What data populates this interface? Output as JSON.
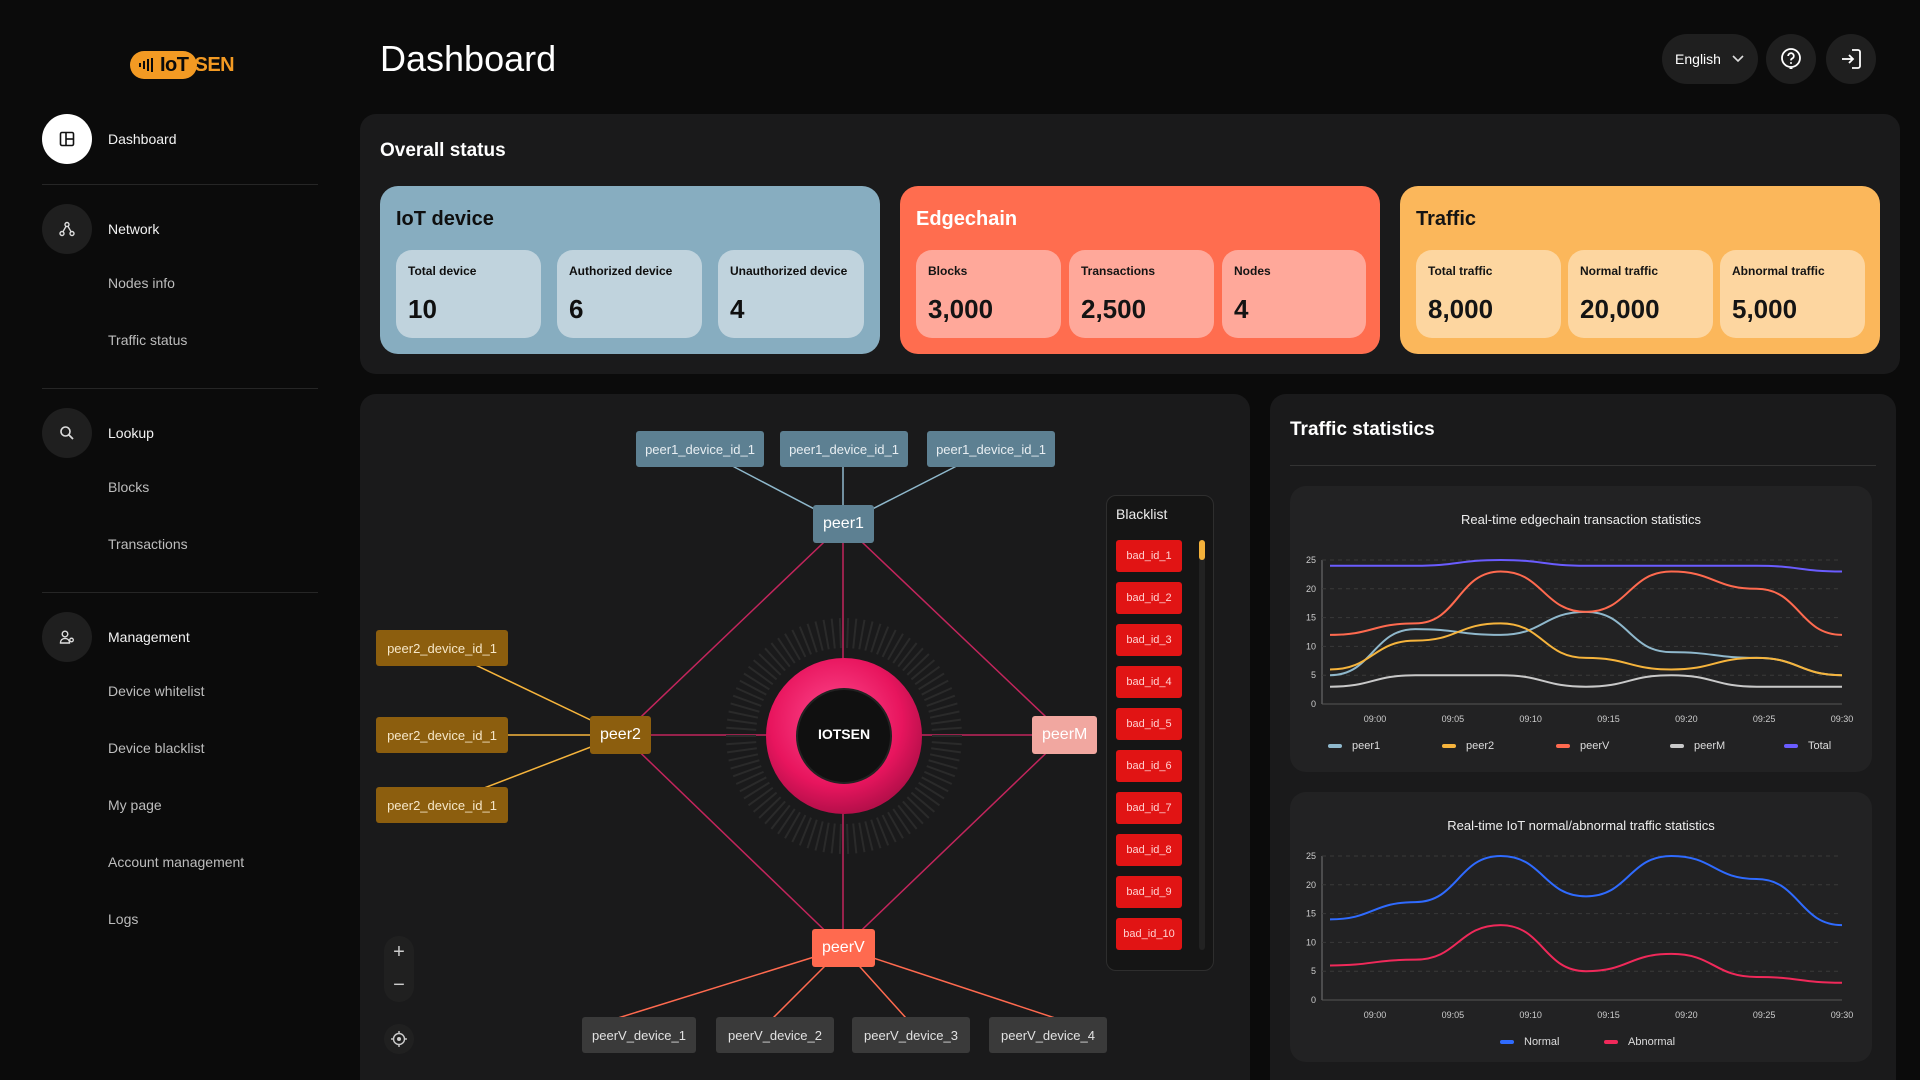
{
  "app": {
    "logo_text_left": "IoT",
    "logo_text_right": "SEN",
    "page_title": "Dashboard"
  },
  "header": {
    "language": "English",
    "help_icon": "help-icon",
    "logout_icon": "logout-icon"
  },
  "sidebar": {
    "dashboard": "Dashboard",
    "network": "Network",
    "nodes_info": "Nodes info",
    "traffic_status": "Traffic status",
    "lookup": "Lookup",
    "blocks": "Blocks",
    "transactions": "Transactions",
    "management": "Management",
    "device_whitelist": "Device whitelist",
    "device_blacklist": "Device blacklist",
    "my_page": "My page",
    "account_management": "Account management",
    "logs": "Logs"
  },
  "overall": {
    "title": "Overall status",
    "iot": {
      "title": "IoT device",
      "total_label": "Total device",
      "total": "10",
      "auth_label": "Authorized device",
      "auth": "6",
      "unauth_label": "Unauthorized device",
      "unauth": "4"
    },
    "edge": {
      "title": "Edgechain",
      "blocks_label": "Blocks",
      "blocks": "3,000",
      "tx_label": "Transactions",
      "tx": "2,500",
      "nodes_label": "Nodes",
      "nodes": "4"
    },
    "traffic": {
      "title": "Traffic",
      "total_label": "Total traffic",
      "total": "8,000",
      "normal_label": "Normal traffic",
      "normal": "20,000",
      "abnormal_label": "Abnormal traffic",
      "abnormal": "5,000"
    }
  },
  "network": {
    "center": "IOTSEN",
    "peer1": "peer1",
    "peer2": "peer2",
    "peerM": "peerM",
    "peerV": "peerV",
    "peer1_devices": [
      "peer1_device_id_1",
      "peer1_device_id_1",
      "peer1_device_id_1"
    ],
    "peer2_devices": [
      "peer2_device_id_1",
      "peer2_device_id_1",
      "peer2_device_id_1"
    ],
    "peerV_devices": [
      "peerV_device_1",
      "peerV_device_2",
      "peerV_device_3",
      "peerV_device_4"
    ],
    "blacklist_title": "Blacklist",
    "blacklist": [
      "bad_id_1",
      "bad_id_2",
      "bad_id_3",
      "bad_id_4",
      "bad_id_5",
      "bad_id_6",
      "bad_id_7",
      "bad_id_8",
      "bad_id_9",
      "bad_id_10"
    ],
    "zoom_in": "+",
    "zoom_out": "−"
  },
  "traffic_stats": {
    "title": "Traffic statistics",
    "colors": {
      "peer1": "#8fb8cc",
      "peer2": "#f6b43c",
      "peerV": "#ff6a4f",
      "peerM": "#c9c9c9",
      "Total": "#6a5cff",
      "Normal": "#2f6bff",
      "Abnormal": "#f0295a"
    }
  },
  "chart_data": [
    {
      "type": "line",
      "title": "Real-time edgechain transaction statistics",
      "x": [
        "09:00",
        "09:05",
        "09:10",
        "09:15",
        "09:20",
        "09:25",
        "09:30"
      ],
      "ylim": [
        0,
        25
      ],
      "yticks": [
        0,
        5,
        10,
        15,
        20,
        25
      ],
      "grid": true,
      "legend_position": "bottom",
      "series": [
        {
          "name": "peer1",
          "values": [
            5,
            13,
            12,
            16,
            9,
            8,
            5
          ]
        },
        {
          "name": "peer2",
          "values": [
            6,
            11,
            14,
            8,
            6,
            8,
            5
          ]
        },
        {
          "name": "peerV",
          "values": [
            12,
            14,
            23,
            16,
            23,
            20,
            12
          ]
        },
        {
          "name": "peerM",
          "values": [
            3,
            5,
            5,
            3,
            5,
            3,
            3
          ]
        },
        {
          "name": "Total",
          "values": [
            24,
            24,
            25,
            24,
            24,
            24,
            23
          ]
        }
      ]
    },
    {
      "type": "line",
      "title": "Real-time IoT normal/abnormal traffic statistics",
      "x": [
        "09:00",
        "09:05",
        "09:10",
        "09:15",
        "09:20",
        "09:25",
        "09:30"
      ],
      "ylim": [
        0,
        25
      ],
      "yticks": [
        0,
        5,
        10,
        15,
        20,
        25
      ],
      "grid": true,
      "legend_position": "bottom",
      "series": [
        {
          "name": "Normal",
          "values": [
            14,
            17,
            25,
            18,
            25,
            21,
            13
          ]
        },
        {
          "name": "Abnormal",
          "values": [
            6,
            7,
            13,
            5,
            8,
            4,
            3
          ]
        }
      ]
    }
  ]
}
